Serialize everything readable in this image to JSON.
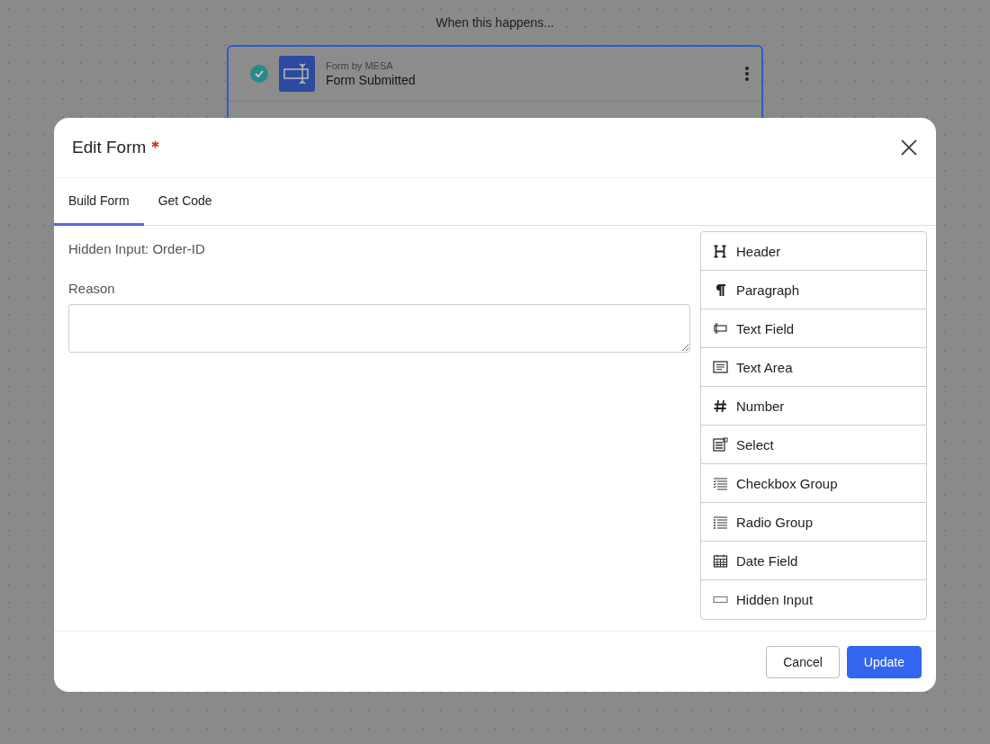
{
  "background": {
    "heading": "When this happens...",
    "trigger": {
      "checked": true,
      "app": "Form by MESA",
      "event": "Form Submitted"
    }
  },
  "modal": {
    "title": "Edit Form",
    "required": true,
    "tabs": [
      {
        "label": "Build Form",
        "selected": true
      },
      {
        "label": "Get Code",
        "selected": false
      }
    ],
    "fields": [
      {
        "kind": "hidden",
        "label": "Hidden Input: Order-ID"
      },
      {
        "kind": "textarea",
        "label": "Reason"
      }
    ],
    "palette": [
      {
        "kind": "header",
        "label": "Header"
      },
      {
        "kind": "paragraph",
        "label": "Paragraph"
      },
      {
        "kind": "text-field",
        "label": "Text Field"
      },
      {
        "kind": "text-area",
        "label": "Text Area"
      },
      {
        "kind": "number",
        "label": "Number"
      },
      {
        "kind": "select",
        "label": "Select"
      },
      {
        "kind": "checkbox-group",
        "label": "Checkbox Group"
      },
      {
        "kind": "radio-group",
        "label": "Radio Group"
      },
      {
        "kind": "date",
        "label": "Date Field"
      },
      {
        "kind": "hidden",
        "label": "Hidden Input"
      }
    ],
    "buttons": [
      {
        "kind": "secondary",
        "label": "Cancel"
      },
      {
        "kind": "primary",
        "label": "Update"
      }
    ]
  }
}
